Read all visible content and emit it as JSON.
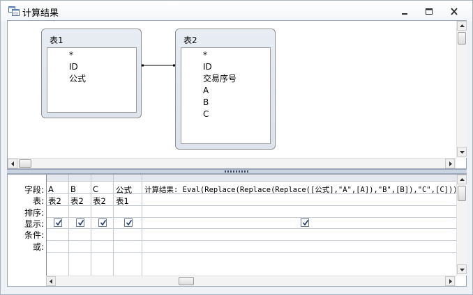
{
  "window": {
    "title": "计算结果"
  },
  "tables": [
    {
      "name": "表1",
      "fields": [
        "*",
        "ID",
        "公式"
      ]
    },
    {
      "name": "表2",
      "fields": [
        "*",
        "ID",
        "交易序号",
        "A",
        "B",
        "C"
      ]
    }
  ],
  "grid": {
    "row_labels": [
      "字段:",
      "表:",
      "排序:",
      "显示:",
      "条件:",
      "或:"
    ],
    "columns": [
      {
        "field": "A",
        "table": "表2",
        "show": true
      },
      {
        "field": "B",
        "table": "表2",
        "show": true
      },
      {
        "field": "C",
        "table": "表2",
        "show": true
      },
      {
        "field": "公式",
        "table": "表1",
        "show": true
      },
      {
        "field": "计算结果: Eval(Replace(Replace(Replace([公式],\"A\",[A]),\"B\",[B]),\"C\",[C]))",
        "table": "",
        "show": true
      }
    ]
  },
  "icons": {
    "title": "query-icon",
    "minimize": "minimize-icon",
    "maximize": "maximize-icon",
    "close": "close-icon"
  }
}
